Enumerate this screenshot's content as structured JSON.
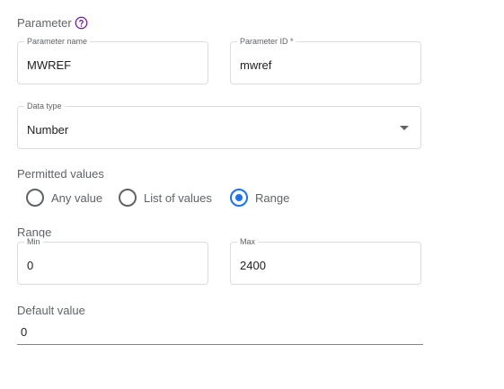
{
  "parameter_section": {
    "title": "Parameter",
    "help_icon": "help-circle-icon"
  },
  "parameter_name": {
    "label": "Parameter name",
    "value": "MWREF"
  },
  "parameter_id": {
    "label": "Parameter ID *",
    "value": "mwref"
  },
  "data_type": {
    "label": "Data type",
    "value": "Number",
    "dropdown_icon": "caret-down-icon"
  },
  "permitted_values": {
    "title": "Permitted values",
    "options": [
      {
        "label": "Any value",
        "selected": false
      },
      {
        "label": "List of values",
        "selected": false
      },
      {
        "label": "Range",
        "selected": true
      }
    ]
  },
  "range": {
    "title": "Range",
    "min": {
      "label": "Min",
      "value": "0"
    },
    "max": {
      "label": "Max",
      "value": "2400"
    }
  },
  "default_value": {
    "label": "Default value",
    "value": "0"
  },
  "colors": {
    "accent": "#1a73e8",
    "help_icon": "#6a1b9a",
    "border": "#dadce0",
    "muted_text": "#5f6368"
  }
}
